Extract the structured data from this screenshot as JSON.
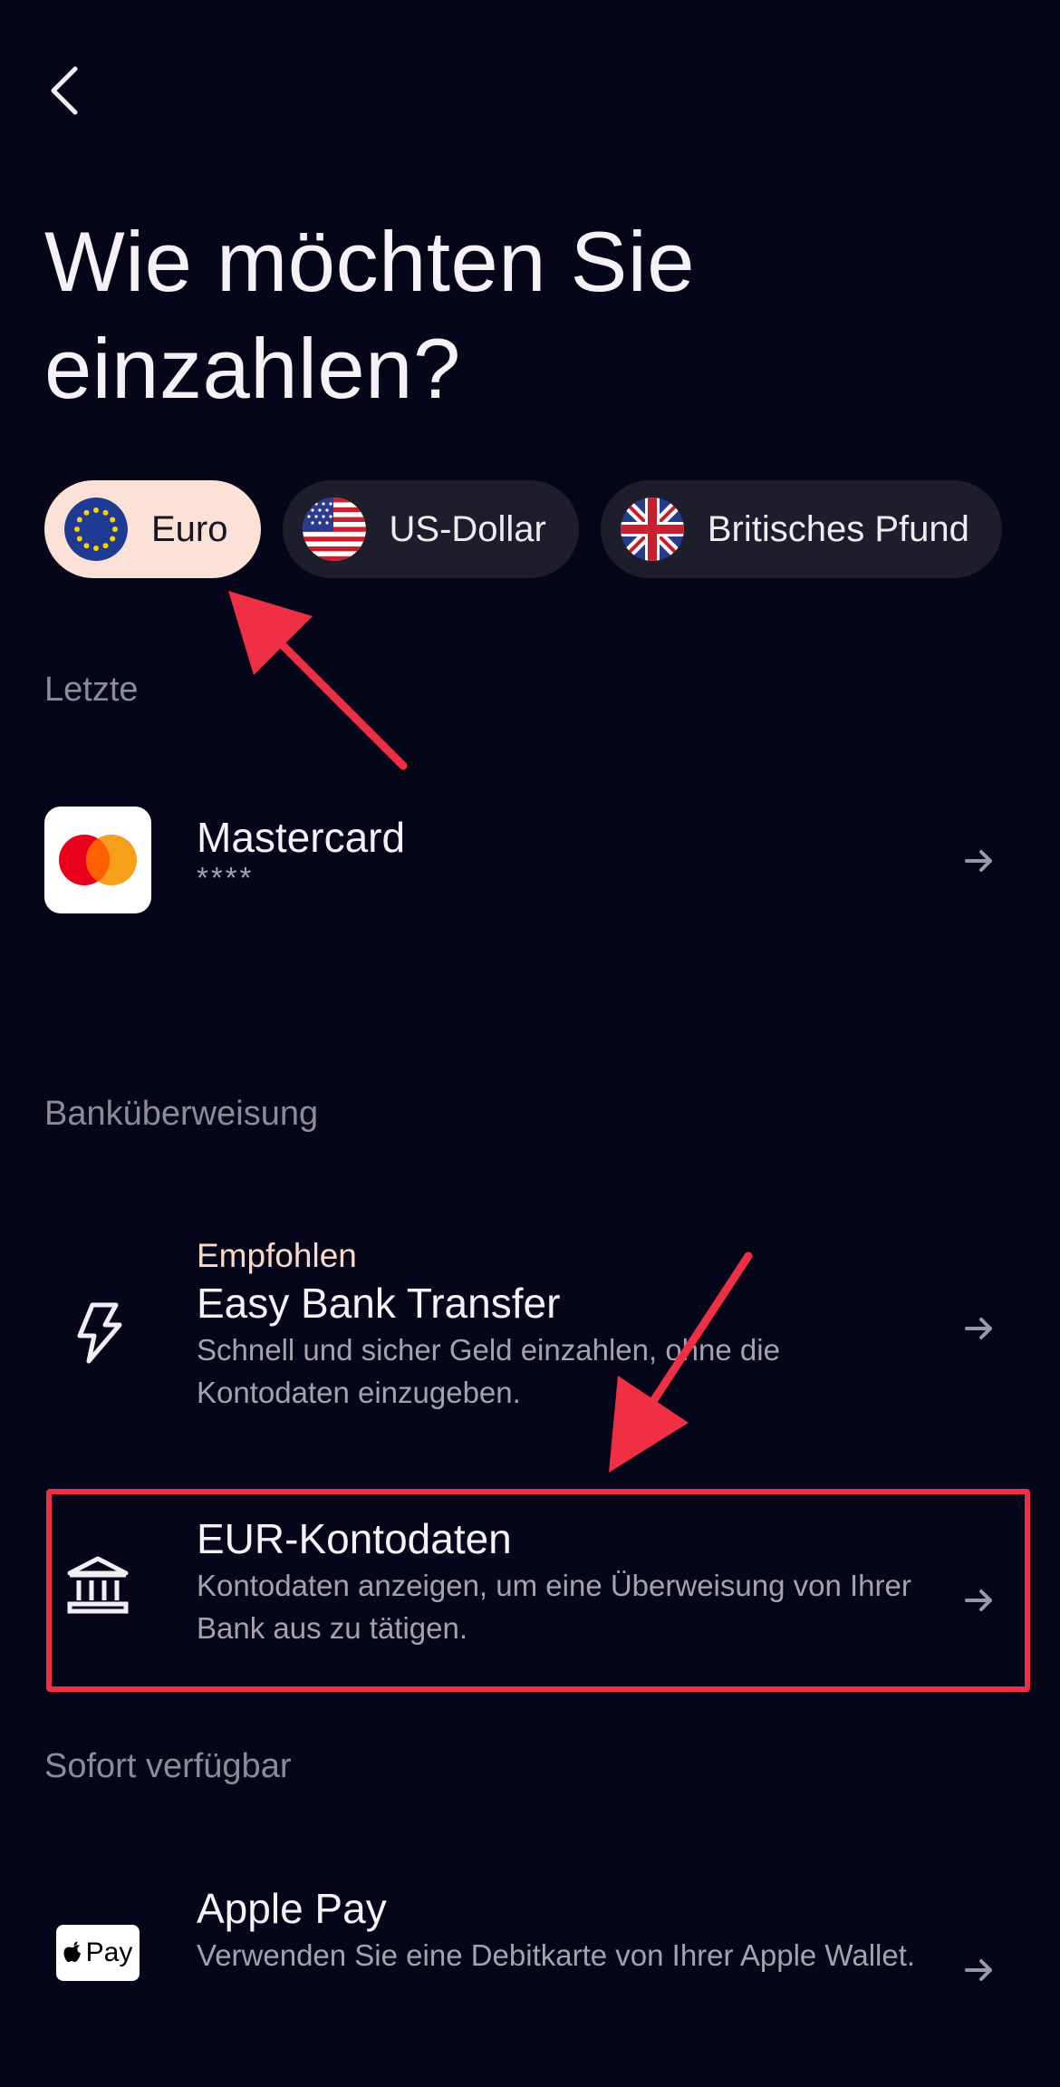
{
  "title": "Wie möchten Sie einzahlen?",
  "currencies": [
    {
      "label": "Euro",
      "selected": true
    },
    {
      "label": "US-Dollar",
      "selected": false
    },
    {
      "label": "Britisches Pfund",
      "selected": false
    }
  ],
  "sections": {
    "recent": "Letzte",
    "bank": "Banküberweisung",
    "instant": "Sofort verfügbar"
  },
  "rows": {
    "mastercard": {
      "title": "Mastercard",
      "subtitle": "****"
    },
    "easy": {
      "eyebrow": "Empfohlen",
      "title": "Easy Bank Transfer",
      "subtitle": "Schnell und sicher Geld einzahlen, ohne die Kontodaten einzugeben."
    },
    "eur": {
      "title": "EUR-Kontodaten",
      "subtitle": "Kontodaten anzeigen, um eine Überweisung von Ihrer Bank aus zu tätigen."
    },
    "apple": {
      "title": "Apple Pay",
      "subtitle": "Verwenden Sie eine Debitkarte von Ihrer Apple Wallet.",
      "logo_text": "Pay"
    }
  },
  "colors": {
    "background": "#06061a",
    "selected_chip": "#fbe1d6",
    "chip": "#1e1d2b",
    "annotation": "#ef2f43",
    "accent_text": "#fbd9c9"
  },
  "icons": {
    "back": "chevron-left-icon",
    "eu_flag": "eu-flag-icon",
    "us_flag": "us-flag-icon",
    "uk_flag": "uk-flag-icon",
    "mastercard": "mastercard-logo-icon",
    "lightning": "lightning-icon",
    "bank": "bank-icon",
    "apple_pay": "apple-pay-icon",
    "arrow": "arrow-right-icon"
  }
}
